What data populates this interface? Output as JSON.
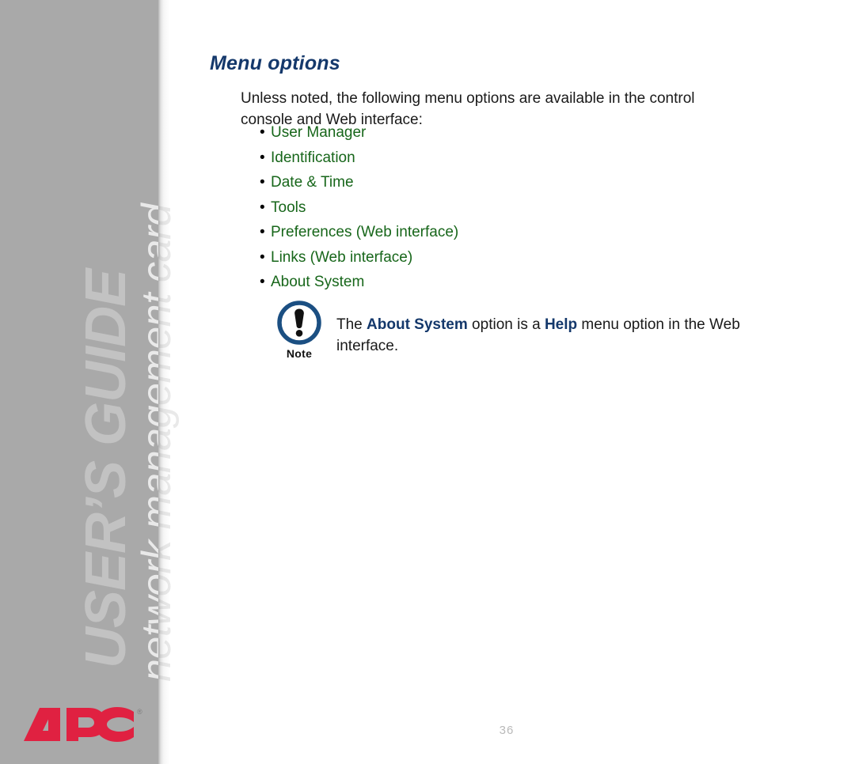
{
  "sidebar": {
    "vertical_title": "USER’S GUIDE",
    "vertical_subtitle": "network management card",
    "logo_text": "APC",
    "logo_trademark": "®"
  },
  "content": {
    "heading": "Menu options",
    "intro_paragraph": "Unless noted, the following menu options are available in the control console and Web interface:",
    "bullet_marker": "•",
    "menu_options": [
      "User Manager",
      "Identification",
      "Date & Time",
      "Tools",
      "Preferences (Web interface)",
      "Links (Web interface)",
      "About System"
    ],
    "note": {
      "label": "Note",
      "icon": "exclamation-circle-icon",
      "text_part1": "The ",
      "emphasis1": "About System",
      "text_part2": " option is a ",
      "emphasis2": "Help",
      "text_part3": " menu option in the Web interface."
    },
    "page_number": "36"
  },
  "colors": {
    "sidebar_bg": "#a9a9a9",
    "heading_blue": "#14386b",
    "menu_green": "#17661a",
    "logo_red": "#e02141",
    "note_ring_blue": "#1b4f82",
    "page_number_grey": "#b9b9b9"
  }
}
